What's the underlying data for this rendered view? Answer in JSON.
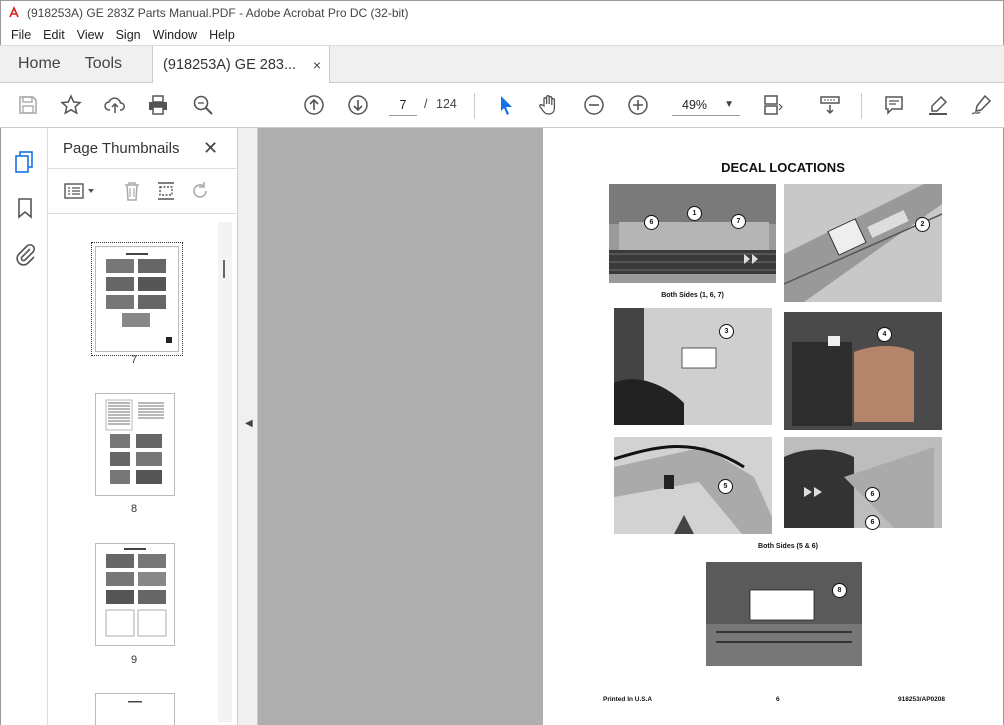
{
  "window": {
    "title": "(918253A) GE 283Z Parts Manual.PDF - Adobe Acrobat Pro DC (32-bit)"
  },
  "menu": [
    "File",
    "Edit",
    "View",
    "Sign",
    "Window",
    "Help"
  ],
  "tabs": {
    "home": "Home",
    "tools": "Tools",
    "document": "(918253A) GE 283...",
    "close": "×"
  },
  "toolbar": {
    "current_page": "7",
    "page_separator": "/",
    "total_pages": "124",
    "zoom": "49%",
    "icons": [
      "save-icon",
      "bookmark-star-icon",
      "upload-icon",
      "print-icon",
      "zoom-search-icon",
      "page-up-icon",
      "page-down-icon",
      "select-arrow-icon",
      "hand-icon",
      "zoom-out-icon",
      "zoom-in-icon",
      "fit-page-icon",
      "scroll-mode-icon",
      "comment-icon",
      "highlight-icon",
      "sign-icon"
    ]
  },
  "sidebar": {
    "title": "Page Thumbnails",
    "close": "✕",
    "thumbnails": [
      {
        "label": "7"
      },
      {
        "label": "8"
      },
      {
        "label": "9"
      }
    ]
  },
  "page": {
    "heading": "DECAL LOCATIONS",
    "captions": {
      "both_sides_1_6_7": "Both Sides (1, 6, 7)",
      "both_sides_5_6": "Both Sides (5 & 6)"
    },
    "callouts": [
      "6",
      "1",
      "7",
      "2",
      "3",
      "4",
      "5",
      "6",
      "6",
      "8"
    ],
    "footer": {
      "left": "Printed In U.S.A",
      "center": "6",
      "right": "918253/AP0208"
    }
  }
}
